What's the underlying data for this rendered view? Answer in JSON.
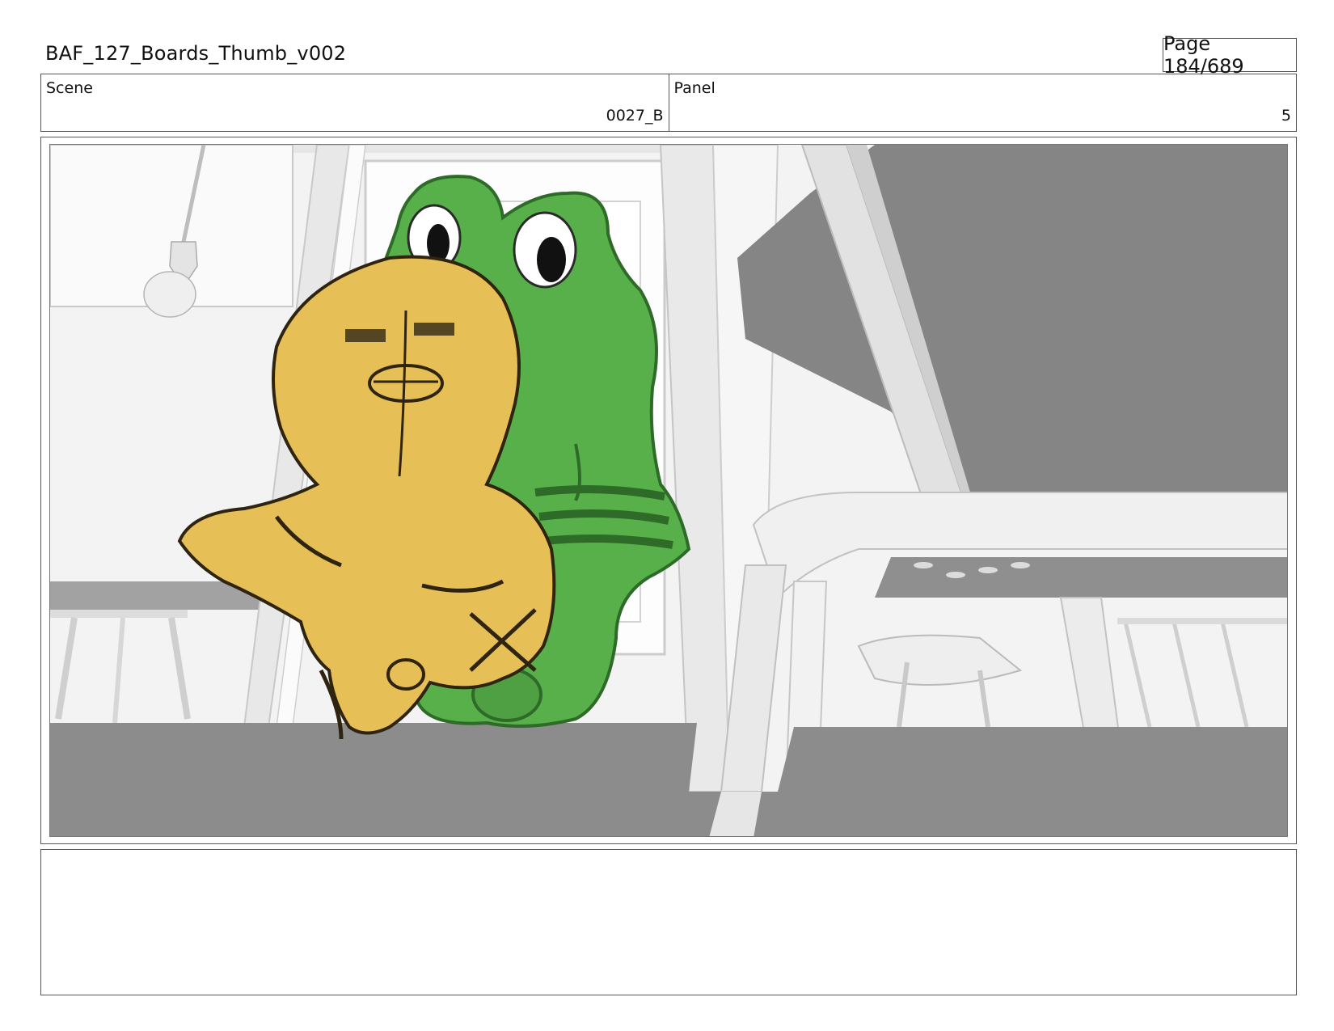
{
  "header": {
    "title": "BAF_127_Boards_Thumb_v002",
    "page": "Page 184/689"
  },
  "info": {
    "scene_label": "Scene",
    "scene_value": "0027_B",
    "panel_label": "Panel",
    "panel_value": "5"
  },
  "frame": {
    "image_description_name": "storyboard-panel-image",
    "colors": {
      "frog_green": "#57b04a",
      "bird_yellow": "#e7bf57",
      "floor_gray": "#8c8c8c",
      "table_gray": "#858585",
      "wall_white": "#f2f2f2"
    }
  },
  "notes": {
    "text": ""
  }
}
